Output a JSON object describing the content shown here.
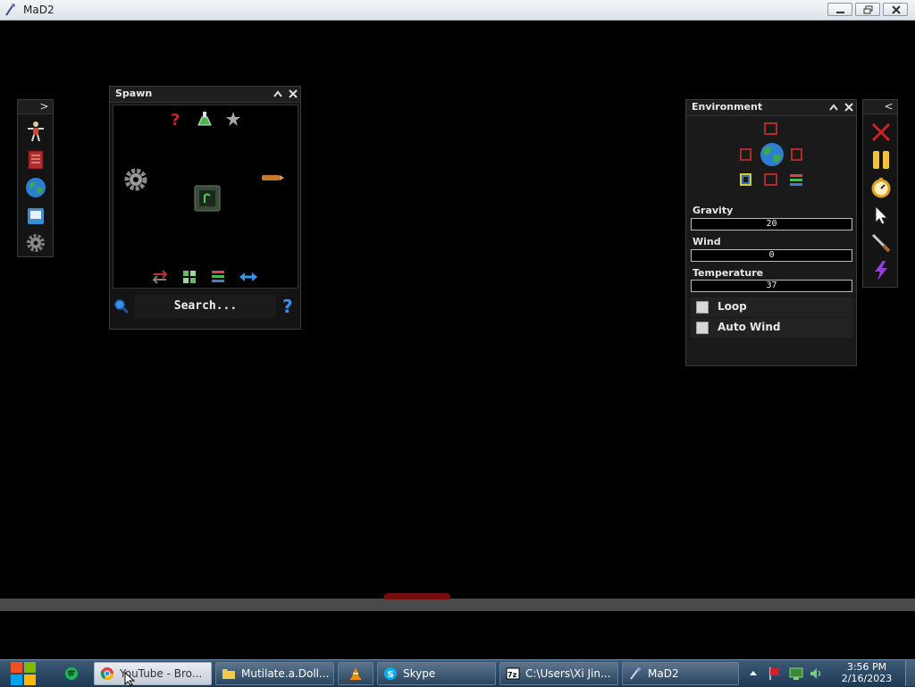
{
  "window": {
    "title": "MaD2"
  },
  "left_toolbar": {
    "toggle_glyph": ">",
    "items": [
      "character-icon",
      "book-icon",
      "globe-icon",
      "save-icon",
      "gear-icon"
    ]
  },
  "spawn": {
    "title": "Spawn",
    "collapse_glyph": "^",
    "close_glyph": "×",
    "search_placeholder": "Search...",
    "help_glyph": "?",
    "top_icons": [
      "question-mark-icon",
      "flask-icon",
      "star-icon"
    ],
    "bottom_icons": [
      "swap-arrows-icon",
      "grid-icon",
      "layers-icon",
      "horizontal-arrows-icon"
    ]
  },
  "environment": {
    "title": "Environment",
    "collapse_glyph": "^",
    "close_glyph": "×",
    "gravity": {
      "label": "Gravity",
      "value": "20"
    },
    "wind": {
      "label": "Wind",
      "value": "0"
    },
    "temperature": {
      "label": "Temperature",
      "value": "37"
    },
    "loop": {
      "label": "Loop",
      "checked": false
    },
    "auto_wind": {
      "label": "Auto Wind",
      "checked": false
    }
  },
  "right_toolbar": {
    "toggle_glyph": "<",
    "items": [
      "close-x-icon",
      "pause-icon",
      "stopwatch-icon",
      "pointer-icon",
      "knife-icon",
      "lightning-icon"
    ]
  },
  "taskbar": {
    "tasks": [
      {
        "label": "YouTube - Bro...",
        "icon": "chrome-icon"
      },
      {
        "label": "Mutilate.a.Doll...",
        "icon": "folder-icon"
      },
      {
        "label": "",
        "icon": "vlc-icon"
      },
      {
        "label": "Skype",
        "icon": "skype-icon"
      },
      {
        "label": "C:\\Users\\Xi Jin...",
        "icon": "archive-icon"
      },
      {
        "label": "MaD2",
        "icon": "mad2-icon"
      }
    ],
    "clock": {
      "time": "3:56 PM",
      "date": "2/16/2023"
    }
  },
  "colors": {
    "accent_red": "#d0202a",
    "accent_yellow": "#f2c33a",
    "globe_blue": "#2c7fd0",
    "help_blue": "#3a8fe6"
  }
}
